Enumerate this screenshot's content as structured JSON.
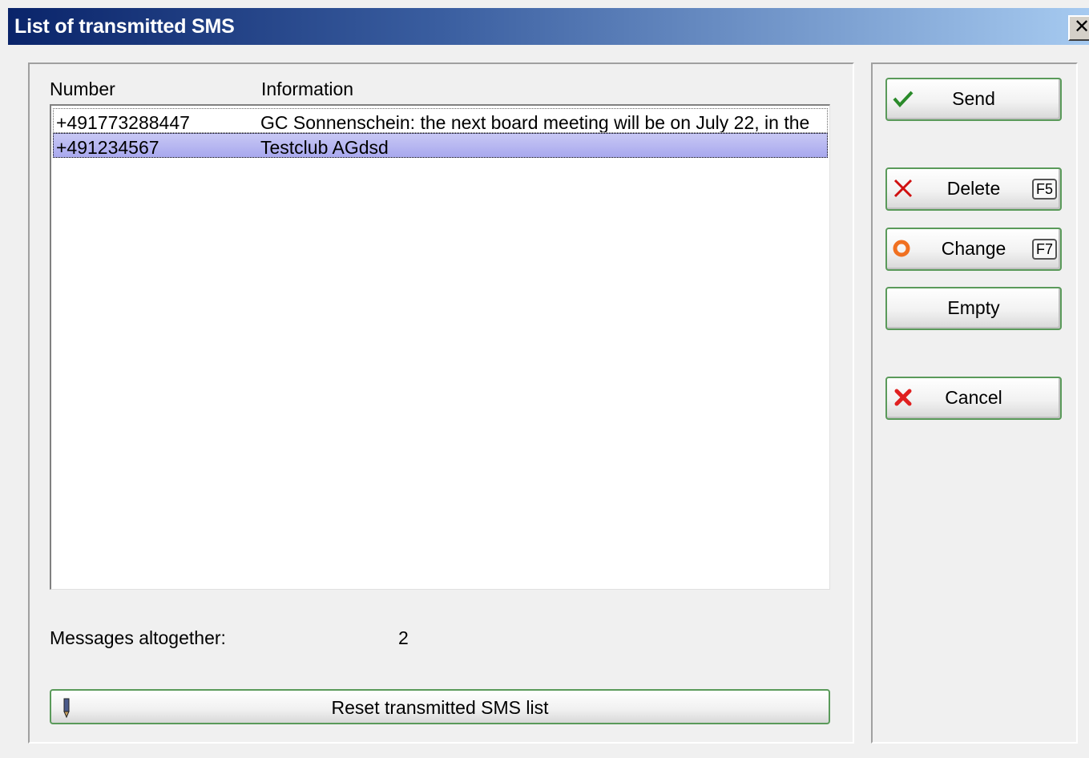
{
  "window": {
    "title": "List of transmitted SMS",
    "close_label": "✕"
  },
  "list": {
    "columns": [
      "Number",
      "Information"
    ],
    "rows": [
      {
        "number": "+491773288447",
        "information": "GC Sonnenschein: the next board meeting will be on July 22, in the"
      },
      {
        "number": "+491234567",
        "information": "Testclub AGdsd"
      }
    ],
    "selected_index": 1
  },
  "summary": {
    "label": "Messages altogether:",
    "count": "2"
  },
  "buttons": {
    "send": "Send",
    "delete": "Delete",
    "delete_key": "F5",
    "change": "Change",
    "change_key": "F7",
    "empty": "Empty",
    "cancel": "Cancel",
    "reset": "Reset transmitted SMS list"
  },
  "icons": {
    "send": "check-icon",
    "delete": "x-icon",
    "change": "ring-icon",
    "cancel": "x-icon",
    "reset": "pen-icon"
  },
  "colors": {
    "titlebar_start": "#0a246a",
    "titlebar_end": "#a6caf0",
    "selection": "#a8a8ee",
    "button_border": "#5a9a5a"
  }
}
